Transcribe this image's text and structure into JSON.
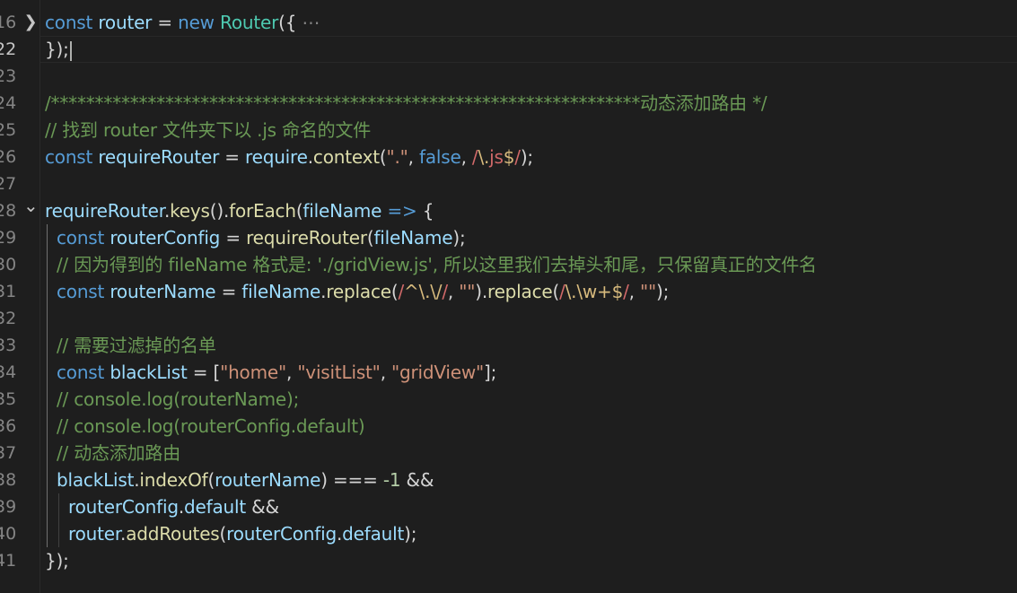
{
  "editor": {
    "lines": [
      {
        "number": "16",
        "fold": "collapsed",
        "tokens": [
          {
            "t": "const",
            "c": "kw"
          },
          {
            "t": " "
          },
          {
            "t": "router",
            "c": "var"
          },
          {
            "t": " = "
          },
          {
            "t": "new",
            "c": "kw"
          },
          {
            "t": " "
          },
          {
            "t": "Router",
            "c": "cls"
          },
          {
            "t": "({ "
          },
          {
            "t": "⋯",
            "c": "ell"
          }
        ]
      },
      {
        "number": "22",
        "active": true,
        "cursor": true,
        "tokens": [
          {
            "t": "});"
          }
        ]
      },
      {
        "number": "23",
        "tokens": []
      },
      {
        "number": "24",
        "tokens": [
          {
            "t": "/*******************************************************************动态添加路由 */",
            "c": "cmt"
          }
        ]
      },
      {
        "number": "25",
        "tokens": [
          {
            "t": "// 找到 router 文件夹下以 .js 命名的文件",
            "c": "cmt"
          }
        ]
      },
      {
        "number": "26",
        "tokens": [
          {
            "t": "const",
            "c": "kw"
          },
          {
            "t": " "
          },
          {
            "t": "requireRouter",
            "c": "var"
          },
          {
            "t": " = "
          },
          {
            "t": "require",
            "c": "var"
          },
          {
            "t": "."
          },
          {
            "t": "context",
            "c": "fn"
          },
          {
            "t": "("
          },
          {
            "t": "\".\"",
            "c": "str"
          },
          {
            "t": ", "
          },
          {
            "t": "false",
            "c": "kw"
          },
          {
            "t": ", "
          },
          {
            "t": "/",
            "c": "rx"
          },
          {
            "t": "\\.",
            "c": "rxc"
          },
          {
            "t": "js",
            "c": "rx"
          },
          {
            "t": "$",
            "c": "rxc"
          },
          {
            "t": "/",
            "c": "rx"
          },
          {
            "t": ");"
          }
        ]
      },
      {
        "number": "27",
        "tokens": []
      },
      {
        "number": "28",
        "fold": "expanded",
        "tokens": [
          {
            "t": "requireRouter",
            "c": "var"
          },
          {
            "t": "."
          },
          {
            "t": "keys",
            "c": "fn"
          },
          {
            "t": "()."
          },
          {
            "t": "forEach",
            "c": "fn"
          },
          {
            "t": "("
          },
          {
            "t": "fileName",
            "c": "var"
          },
          {
            "t": " "
          },
          {
            "t": "=>",
            "c": "kw"
          },
          {
            "t": " {"
          }
        ]
      },
      {
        "number": "29",
        "indent": 1,
        "tokens": [
          {
            "t": "const",
            "c": "kw"
          },
          {
            "t": " "
          },
          {
            "t": "routerConfig",
            "c": "var"
          },
          {
            "t": " = "
          },
          {
            "t": "requireRouter",
            "c": "fn"
          },
          {
            "t": "("
          },
          {
            "t": "fileName",
            "c": "var"
          },
          {
            "t": ");"
          }
        ]
      },
      {
        "number": "30",
        "indent": 1,
        "tokens": [
          {
            "t": "// 因为得到的 fileName 格式是: './gridView.js', 所以这里我们去掉头和尾，只保留真正的文件名",
            "c": "cmt"
          }
        ]
      },
      {
        "number": "31",
        "indent": 1,
        "tokens": [
          {
            "t": "const",
            "c": "kw"
          },
          {
            "t": " "
          },
          {
            "t": "routerName",
            "c": "var"
          },
          {
            "t": " = "
          },
          {
            "t": "fileName",
            "c": "var"
          },
          {
            "t": "."
          },
          {
            "t": "replace",
            "c": "fn"
          },
          {
            "t": "("
          },
          {
            "t": "/",
            "c": "rx"
          },
          {
            "t": "^\\.\\/",
            "c": "rxc"
          },
          {
            "t": "/",
            "c": "rx"
          },
          {
            "t": ", "
          },
          {
            "t": "\"\"",
            "c": "str"
          },
          {
            "t": ")."
          },
          {
            "t": "replace",
            "c": "fn"
          },
          {
            "t": "("
          },
          {
            "t": "/",
            "c": "rx"
          },
          {
            "t": "\\.\\w+$",
            "c": "rxc"
          },
          {
            "t": "/",
            "c": "rx"
          },
          {
            "t": ", "
          },
          {
            "t": "\"\"",
            "c": "str"
          },
          {
            "t": ");"
          }
        ]
      },
      {
        "number": "32",
        "indent": 1,
        "tokens": []
      },
      {
        "number": "33",
        "indent": 1,
        "tokens": [
          {
            "t": "// 需要过滤掉的名单",
            "c": "cmt"
          }
        ]
      },
      {
        "number": "34",
        "indent": 1,
        "tokens": [
          {
            "t": "const",
            "c": "kw"
          },
          {
            "t": " "
          },
          {
            "t": "blackList",
            "c": "var"
          },
          {
            "t": " = ["
          },
          {
            "t": "\"home\"",
            "c": "str"
          },
          {
            "t": ", "
          },
          {
            "t": "\"visitList\"",
            "c": "str"
          },
          {
            "t": ", "
          },
          {
            "t": "\"gridView\"",
            "c": "str"
          },
          {
            "t": "];"
          }
        ]
      },
      {
        "number": "35",
        "indent": 1,
        "tokens": [
          {
            "t": "// console.log(routerName);",
            "c": "cmt"
          }
        ]
      },
      {
        "number": "36",
        "indent": 1,
        "tokens": [
          {
            "t": "// console.log(routerConfig.default)",
            "c": "cmt"
          }
        ]
      },
      {
        "number": "37",
        "indent": 1,
        "tokens": [
          {
            "t": "// 动态添加路由",
            "c": "cmt"
          }
        ]
      },
      {
        "number": "38",
        "indent": 1,
        "tokens": [
          {
            "t": "blackList",
            "c": "var"
          },
          {
            "t": "."
          },
          {
            "t": "indexOf",
            "c": "fn"
          },
          {
            "t": "("
          },
          {
            "t": "routerName",
            "c": "var"
          },
          {
            "t": ") === "
          },
          {
            "t": "-1",
            "c": "num"
          },
          {
            "t": " &&"
          }
        ]
      },
      {
        "number": "39",
        "indent": 2,
        "tokens": [
          {
            "t": "routerConfig",
            "c": "var"
          },
          {
            "t": "."
          },
          {
            "t": "default",
            "c": "var"
          },
          {
            "t": " &&"
          }
        ]
      },
      {
        "number": "40",
        "indent": 2,
        "tokens": [
          {
            "t": "router",
            "c": "var"
          },
          {
            "t": "."
          },
          {
            "t": "addRoutes",
            "c": "fn"
          },
          {
            "t": "("
          },
          {
            "t": "routerConfig",
            "c": "var"
          },
          {
            "t": "."
          },
          {
            "t": "default",
            "c": "var"
          },
          {
            "t": ");"
          }
        ]
      },
      {
        "number": "41",
        "tokens": [
          {
            "t": "});"
          }
        ]
      }
    ]
  }
}
